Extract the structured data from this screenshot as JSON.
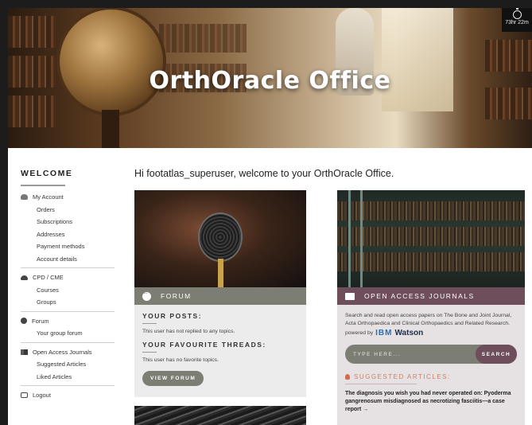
{
  "hero": {
    "title": "OrthOracle Office"
  },
  "timer": {
    "label": "73hr 22m"
  },
  "sidebar": {
    "heading": "WELCOME",
    "sections": [
      {
        "label": "My Account",
        "icon": "user-icon",
        "items": [
          "Orders",
          "Subscriptions",
          "Addresses",
          "Payment methods",
          "Account details"
        ]
      },
      {
        "label": "CPD / CME",
        "icon": "cloud-icon",
        "items": [
          "Courses",
          "Groups"
        ]
      },
      {
        "label": "Forum",
        "icon": "chat-icon",
        "items": [
          "Your group forum"
        ]
      },
      {
        "label": "Open Access Journals",
        "icon": "book-icon",
        "items": [
          "Suggested Articles",
          "Liked Articles"
        ]
      },
      {
        "label": "Logout",
        "icon": "logout-icon",
        "items": []
      }
    ]
  },
  "main": {
    "welcome": "Hi footatlas_superuser, welcome to your OrthOracle Office."
  },
  "forum": {
    "bar_label": "FORUM",
    "posts_heading": "YOUR POSTS:",
    "posts_text": "This user has not replied to any topics.",
    "threads_heading": "YOUR FAVOURITE THREADS:",
    "threads_text": "This user has no favorite topics.",
    "button": "VIEW FORUM"
  },
  "journals": {
    "bar_label": "OPEN ACCESS JOURNALS",
    "description": "Search and read open access papers on The Bone and Joint Journal, Acta Orthopaedica and Clinical Orthopaedics and Related Research.",
    "powered_by": "powered by",
    "brand_ibm": "IBM",
    "brand_watson": "Watson",
    "search_placeholder": "TYPE HERE...",
    "search_button": "SEARCH",
    "suggested_heading": "SUGGESTED ARTICLES:",
    "article_title": "The diagnosis you wish you had never operated on: Pyoderma gangrenosum misdiagnosed as necrotizing fasciitis—a case report →"
  }
}
